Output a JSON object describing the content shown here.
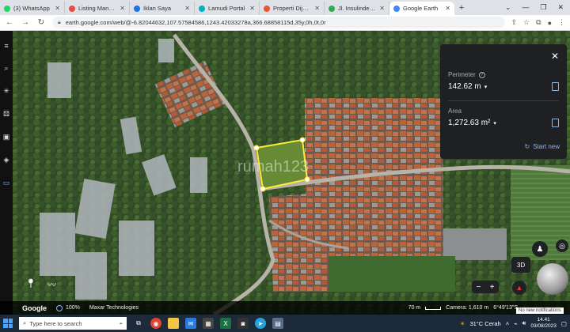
{
  "tabs": [
    {
      "title": "(3) WhatsApp",
      "color": "#25d366"
    },
    {
      "title": "Listing Managem",
      "color": "#e74c3c"
    },
    {
      "title": "Iklan Saya",
      "color": "#1a73e8"
    },
    {
      "title": "Lamudi Portal",
      "color": "#00b0c8"
    },
    {
      "title": "Properti Dijual di",
      "color": "#e8552d"
    },
    {
      "title": "Jl. Insulinde Inda",
      "color": "#34a853"
    },
    {
      "title": "Google Earth",
      "color": "#4285f4"
    }
  ],
  "address": {
    "url": "earth.google.com/web/@-6.82044632,107.57584586,1243.42033278a,366.68858115d,35y,0h,0t,0r"
  },
  "panel": {
    "perimeter_label": "Perimeter",
    "perimeter_value": "142.62 m",
    "area_label": "Area",
    "area_value": "1,272.63 m²",
    "start_new": "Start new"
  },
  "status": {
    "logo": "Google",
    "zoom": "100%",
    "attribution": "Maxar Technologies",
    "scale": "70 m",
    "camera": "Camera: 1,610 m",
    "coords": "6°49'13\"S"
  },
  "map_controls": {
    "btn3d": "3D"
  },
  "watermark": "rumah123",
  "notification": "No new notifications",
  "taskbar": {
    "search_placeholder": "Type here to search",
    "weather": "31°C  Cerah",
    "time": "14.41",
    "date": "03/08/2023"
  }
}
